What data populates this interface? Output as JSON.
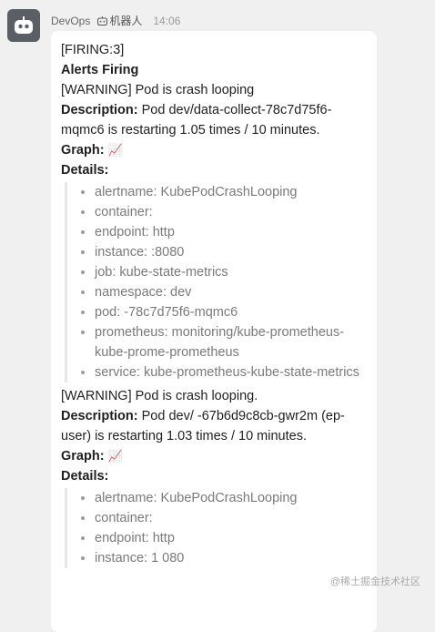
{
  "sender": {
    "name": "DevOps",
    "badge": "机器人",
    "time": "14:06"
  },
  "message": {
    "header": "[FIRING:3]",
    "title": "Alerts Firing",
    "alerts": [
      {
        "level": "[WARNING] Pod is crash looping",
        "desc_label": "Description:",
        "desc_text": " Pod dev/data-collect-78c7d75f6-mqmc6  is restarting 1.05 times / 10 minutes.",
        "graph_label": "Graph:",
        "graph_emoji": "📈",
        "details_label": "Details:",
        "details": [
          "alertname: KubePodCrashLooping",
          "container: ",
          "endpoint: http",
          "instance: :8080",
          "job: kube-state-metrics",
          "namespace: dev",
          "pod: -78c7d75f6-mqmc6",
          "prometheus: monitoring/kube-prometheus-",
          "kube-prome-prometheus",
          "service: kube-prometheus-kube-state-metrics"
        ]
      },
      {
        "level": "[WARNING] Pod is crash looping.",
        "desc_label": "Description:",
        "desc_text": " Pod dev/ -67b6d9c8cb-gwr2m (ep-user) is restarting 1.03 times / 10 minutes.",
        "graph_label": "Graph:",
        "graph_emoji": "📈",
        "details_label": "Details:",
        "details": [
          "alertname: KubePodCrashLooping",
          "container: ",
          "endpoint: http",
          "instance: 1 080"
        ]
      }
    ]
  },
  "watermark": "@稀土掘金技术社区"
}
